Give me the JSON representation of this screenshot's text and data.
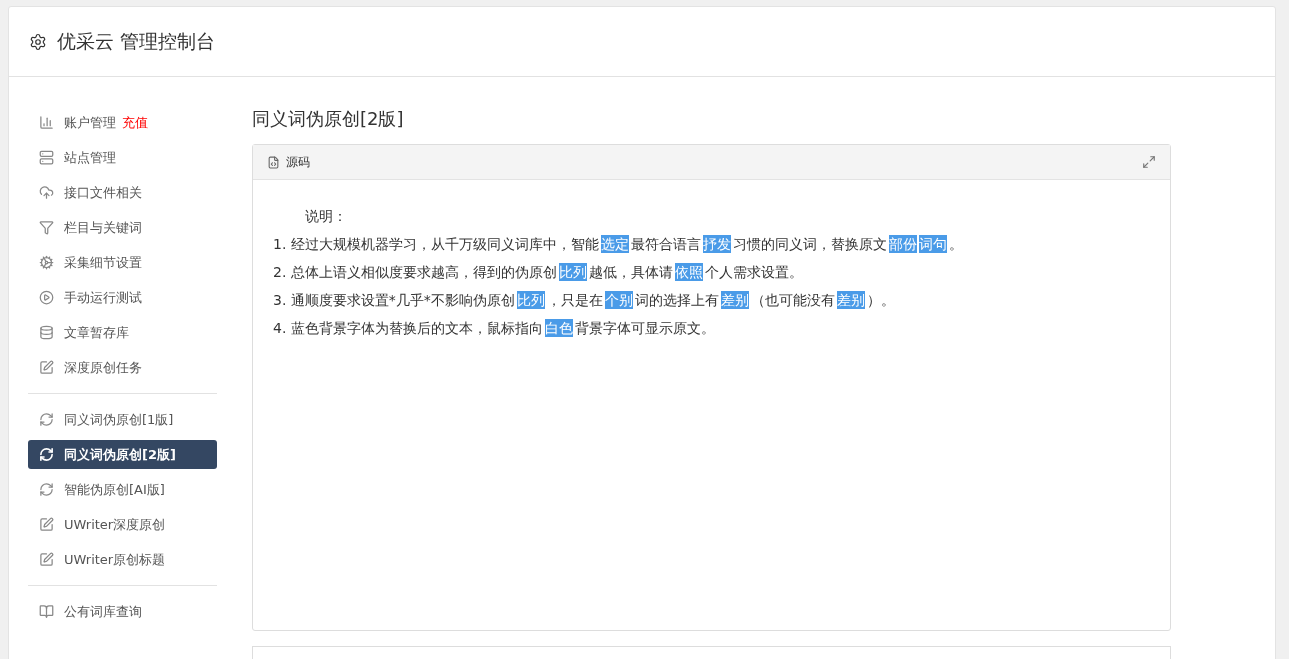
{
  "header": {
    "title": "优采云 管理控制台"
  },
  "sidebar": {
    "sections": [
      {
        "items": [
          {
            "label": "账户管理",
            "badge": "充值",
            "selected": false
          },
          {
            "label": "站点管理",
            "selected": false
          },
          {
            "label": "接口文件相关",
            "selected": false
          },
          {
            "label": "栏目与关键词",
            "selected": false
          },
          {
            "label": "采集细节设置",
            "selected": false
          },
          {
            "label": "手动运行测试",
            "selected": false
          },
          {
            "label": "文章暂存库",
            "selected": false
          },
          {
            "label": "深度原创任务",
            "selected": false
          }
        ]
      },
      {
        "items": [
          {
            "label": "同义词伪原创[1版]",
            "selected": false
          },
          {
            "label": "同义词伪原创[2版]",
            "selected": true
          },
          {
            "label": "智能伪原创[AI版]",
            "selected": false
          },
          {
            "label": "UWriter深度原创",
            "selected": false
          },
          {
            "label": "UWriter原创标题",
            "selected": false
          }
        ]
      },
      {
        "items": [
          {
            "label": "公有词库查询",
            "selected": false
          }
        ]
      }
    ]
  },
  "main": {
    "title": "同义词伪原创[2版]",
    "editor": {
      "tab": "源码",
      "heading": "说明：",
      "lines": [
        [
          {
            "text": "1. 经过大规模机器学习，从千万级同义词库中，智能",
            "highlighted": false
          },
          {
            "text": "选定",
            "highlighted": true
          },
          {
            "text": "最符合语言",
            "highlighted": false
          },
          {
            "text": "抒发",
            "highlighted": true
          },
          {
            "text": "习惯的同义词，替换原文",
            "highlighted": false
          },
          {
            "text": "部份",
            "highlighted": true
          },
          {
            "text": "词句",
            "highlighted": true
          },
          {
            "text": "。",
            "highlighted": false
          }
        ],
        [
          {
            "text": "2. 总体上语义相似度要求越高，得到的伪原创",
            "highlighted": false
          },
          {
            "text": "比列",
            "highlighted": true
          },
          {
            "text": "越低，具体请",
            "highlighted": false
          },
          {
            "text": "依照",
            "highlighted": true
          },
          {
            "text": "个人需求设置。",
            "highlighted": false
          }
        ],
        [
          {
            "text": "3. 通顺度要求设置*几乎*不影响伪原创",
            "highlighted": false
          },
          {
            "text": "比列",
            "highlighted": true
          },
          {
            "text": "，只是在",
            "highlighted": false
          },
          {
            "text": "个别",
            "highlighted": true
          },
          {
            "text": "词的选择上有",
            "highlighted": false
          },
          {
            "text": "差别",
            "highlighted": true
          },
          {
            "text": "（也可能没有",
            "highlighted": false
          },
          {
            "text": "差别",
            "highlighted": true
          },
          {
            "text": "）。",
            "highlighted": false
          }
        ],
        [
          {
            "text": "4. 蓝色背景字体为替换后的文本，鼠标指向",
            "highlighted": false
          },
          {
            "text": "白色",
            "highlighted": true
          },
          {
            "text": "背景字体可显示原文。",
            "highlighted": false
          }
        ]
      ]
    }
  }
}
